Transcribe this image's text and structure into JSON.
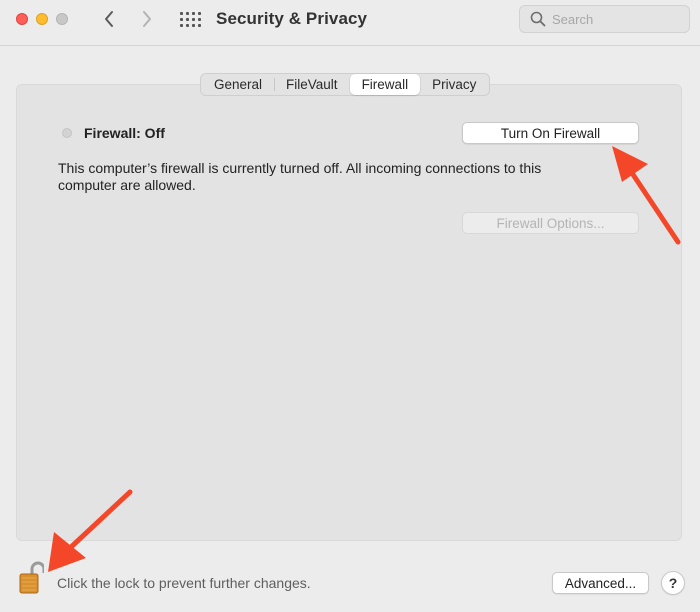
{
  "window": {
    "title": "Security & Privacy"
  },
  "search": {
    "placeholder": "Search",
    "value": "",
    "icon": "magnifying-glass-icon"
  },
  "tabs": [
    {
      "label": "General",
      "active": false
    },
    {
      "label": "FileVault",
      "active": false
    },
    {
      "label": "Firewall",
      "active": true
    },
    {
      "label": "Privacy",
      "active": false
    }
  ],
  "firewall": {
    "status_label": "Firewall: Off",
    "turn_on_label": "Turn On Firewall",
    "description": "This computer’s firewall is currently turned off. All incoming connections to this computer are allowed.",
    "options_label": "Firewall Options...",
    "options_enabled": false
  },
  "footer": {
    "lock_text": "Click the lock to prevent further changes.",
    "advanced_label": "Advanced...",
    "help_label": "?"
  },
  "colors": {
    "close": "#fe5f57",
    "minimize": "#febc2e",
    "maximize_disabled": "#c8c8c8",
    "annotation_arrow": "#f4472a",
    "lock_gold": "#d9902d"
  }
}
